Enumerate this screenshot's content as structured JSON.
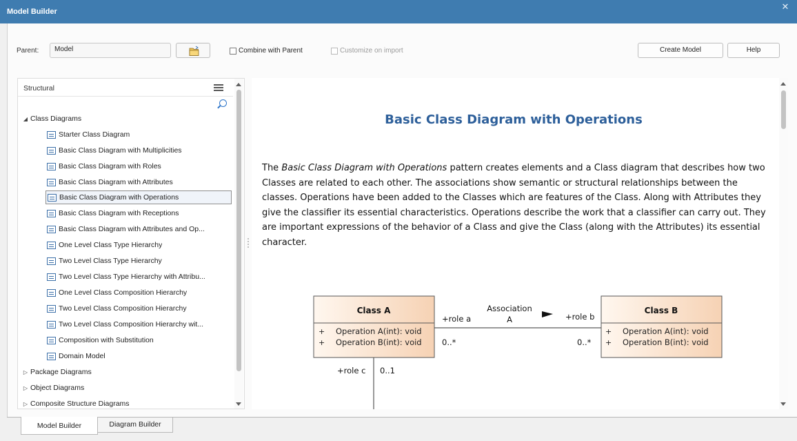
{
  "window": {
    "title": "Model Builder",
    "close_glyph": "✕"
  },
  "toolbar": {
    "parent_label": "Parent:",
    "parent_value": "Model",
    "folder_icon": "folder-icon",
    "combine_label": "Combine with Parent",
    "customize_label": "Customize on import",
    "create_model_label": "Create Model",
    "help_label": "Help"
  },
  "left_panel": {
    "title": "Structural",
    "tree": [
      {
        "label": "Class Diagrams",
        "expanded": true,
        "children": [
          "Starter Class Diagram",
          "Basic Class Diagram with Multiplicities",
          "Basic Class Diagram with Roles",
          "Basic Class Diagram with Attributes",
          "Basic Class Diagram with Operations",
          "Basic Class Diagram with Receptions",
          "Basic Class Diagram with Attributes and Op...",
          "One Level Class Type Hierarchy",
          "Two Level Class Type Hierarchy",
          "Two Level Class Type Hierarchy with Attribu...",
          "One Level Class Composition Hierarchy",
          "Two Level Class Composition Hierarchy",
          "Two Level Class Composition Hierarchy wit...",
          "Composition with Substitution",
          "Domain Model"
        ],
        "selected_child": "Basic Class Diagram with Operations"
      },
      {
        "label": "Package Diagrams",
        "expanded": false
      },
      {
        "label": "Object Diagrams",
        "expanded": false
      },
      {
        "label": "Composite Structure Diagrams",
        "expanded": false
      }
    ]
  },
  "content": {
    "title": "Basic Class Diagram with Operations",
    "body_intro": "The ",
    "body_italic": "Basic Class Diagram with Operations",
    "body_rest": " pattern creates elements and a Class diagram that describes how two Classes are related to each other. The associations show semantic or structural relationships between the classes. Operations have been added to the Classes which are features of the Class. Along with Attributes they give the classifier its essential characteristics. Operations describe the work that a classifier can carry out. They are important expressions of the behavior of a Class and give the Class (along with the Attributes) its essential character.",
    "diagram": {
      "class_a": {
        "name": "Class A",
        "ops": [
          "Operation A(int): void",
          "Operation B(int): void"
        ]
      },
      "class_b": {
        "name": "Class B",
        "ops": [
          "Operation A(int): void",
          "Operation B(int): void"
        ]
      },
      "visibility": "+",
      "association_name_1": "Association",
      "association_name_2": "A",
      "role_a": "+role a",
      "role_b": "+role b",
      "role_c": "+role c",
      "mult_a": "0..*",
      "mult_b": "0..*",
      "mult_c": "0..1"
    }
  },
  "tabs": {
    "active": "Model Builder",
    "inactive": "Diagram Builder"
  }
}
